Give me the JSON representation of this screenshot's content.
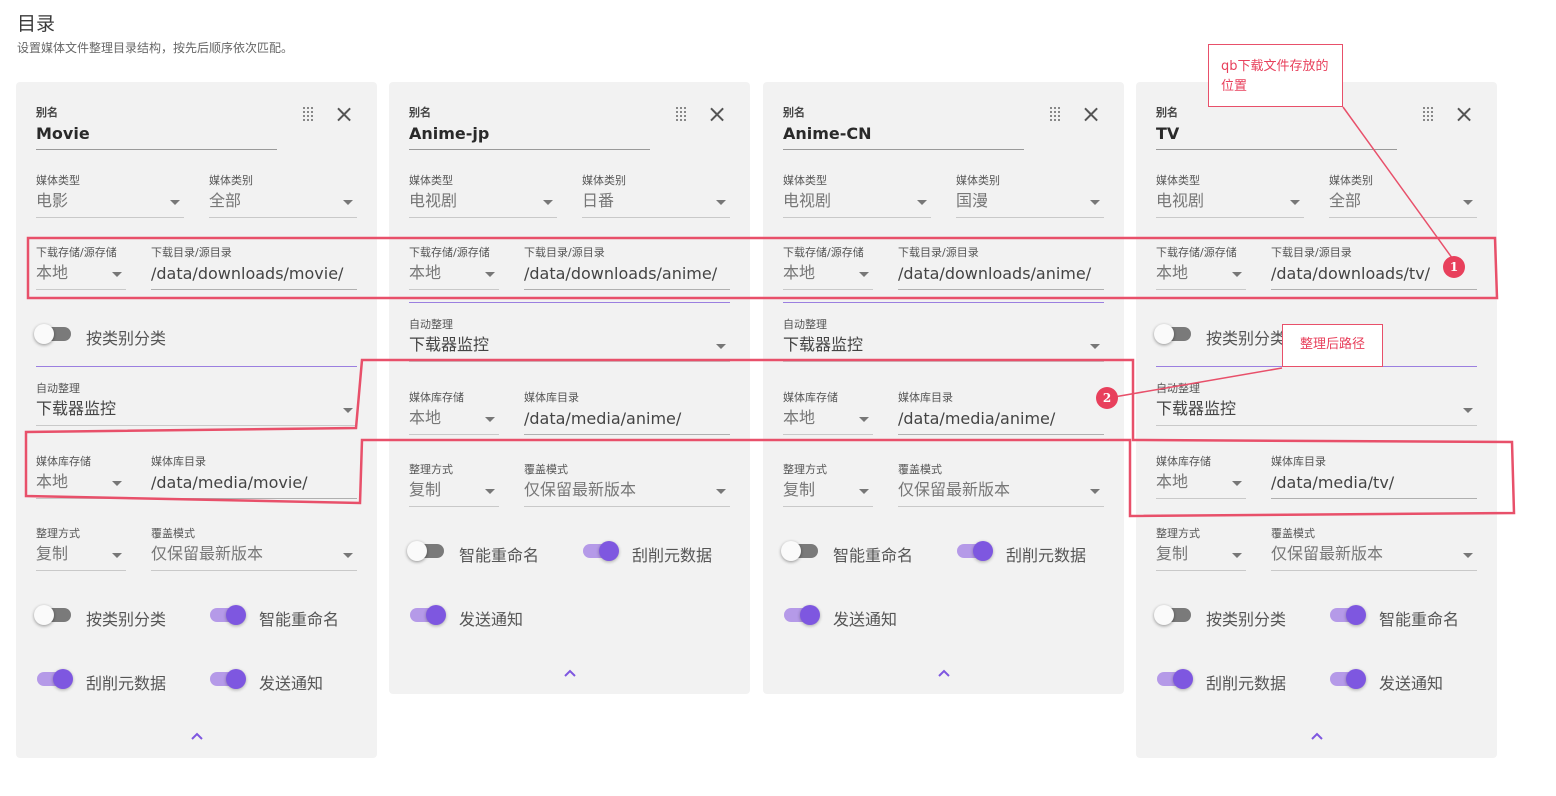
{
  "header": {
    "title": "目录",
    "subtitle": "设置媒体文件整理目录结构，按先后顺序依次匹配。"
  },
  "labels": {
    "alias": "别名",
    "media_type": "媒体类型",
    "media_category": "媒体类别",
    "download_storage": "下载存储/源存储",
    "download_dir": "下载目录/源目录",
    "auto_organize": "自动整理",
    "library_storage": "媒体库存储",
    "library_dir": "媒体库目录",
    "organize_method": "整理方式",
    "overwrite_mode": "覆盖模式",
    "classify_by_category": "按类别分类",
    "smart_rename": "智能重命名",
    "scrape_metadata": "刮削元数据",
    "send_notification": "发送通知"
  },
  "cards": [
    {
      "alias": "Movie",
      "media_type": "电影",
      "media_category": "全部",
      "download_storage": "本地",
      "download_dir": "/data/downloads/movie/",
      "classify_top": false,
      "auto_organize": "下载器监控",
      "library_storage": "本地",
      "library_dir": "/data/media/movie/",
      "organize_method": "复制",
      "overwrite_mode": "仅保留最新版本",
      "classify": false,
      "smart_rename": true,
      "scrape_metadata": true,
      "send_notification": true
    },
    {
      "alias": "Anime-jp",
      "media_type": "电视剧",
      "media_category": "日番",
      "download_storage": "本地",
      "download_dir": "/data/downloads/anime/",
      "auto_organize": "下载器监控",
      "library_storage": "本地",
      "library_dir": "/data/media/anime/",
      "organize_method": "复制",
      "overwrite_mode": "仅保留最新版本",
      "smart_rename": false,
      "scrape_metadata": true,
      "send_notification": true
    },
    {
      "alias": "Anime-CN",
      "media_type": "电视剧",
      "media_category": "国漫",
      "download_storage": "本地",
      "download_dir": "/data/downloads/anime/",
      "auto_organize": "下载器监控",
      "library_storage": "本地",
      "library_dir": "/data/media/anime/",
      "organize_method": "复制",
      "overwrite_mode": "仅保留最新版本",
      "smart_rename": false,
      "scrape_metadata": true,
      "send_notification": true
    },
    {
      "alias": "TV",
      "media_type": "电视剧",
      "media_category": "全部",
      "download_storage": "本地",
      "download_dir": "/data/downloads/tv/",
      "classify_top": false,
      "auto_organize": "下载器监控",
      "library_storage": "本地",
      "library_dir": "/data/media/tv/",
      "organize_method": "复制",
      "overwrite_mode": "仅保留最新版本",
      "classify": false,
      "smart_rename": true,
      "scrape_metadata": true,
      "send_notification": true
    }
  ],
  "annotations": {
    "note1": "qb下载文件存放的位置",
    "note2": "整理后路径",
    "badge1": "1",
    "badge2": "2"
  },
  "colors": {
    "accent": "#7e57e0",
    "annotation": "#e8506a"
  },
  "icons": {
    "drag": "drag-handle-icon",
    "close": "close-icon",
    "dropdown": "chevron-down-icon",
    "collapse": "chevron-up-icon"
  }
}
